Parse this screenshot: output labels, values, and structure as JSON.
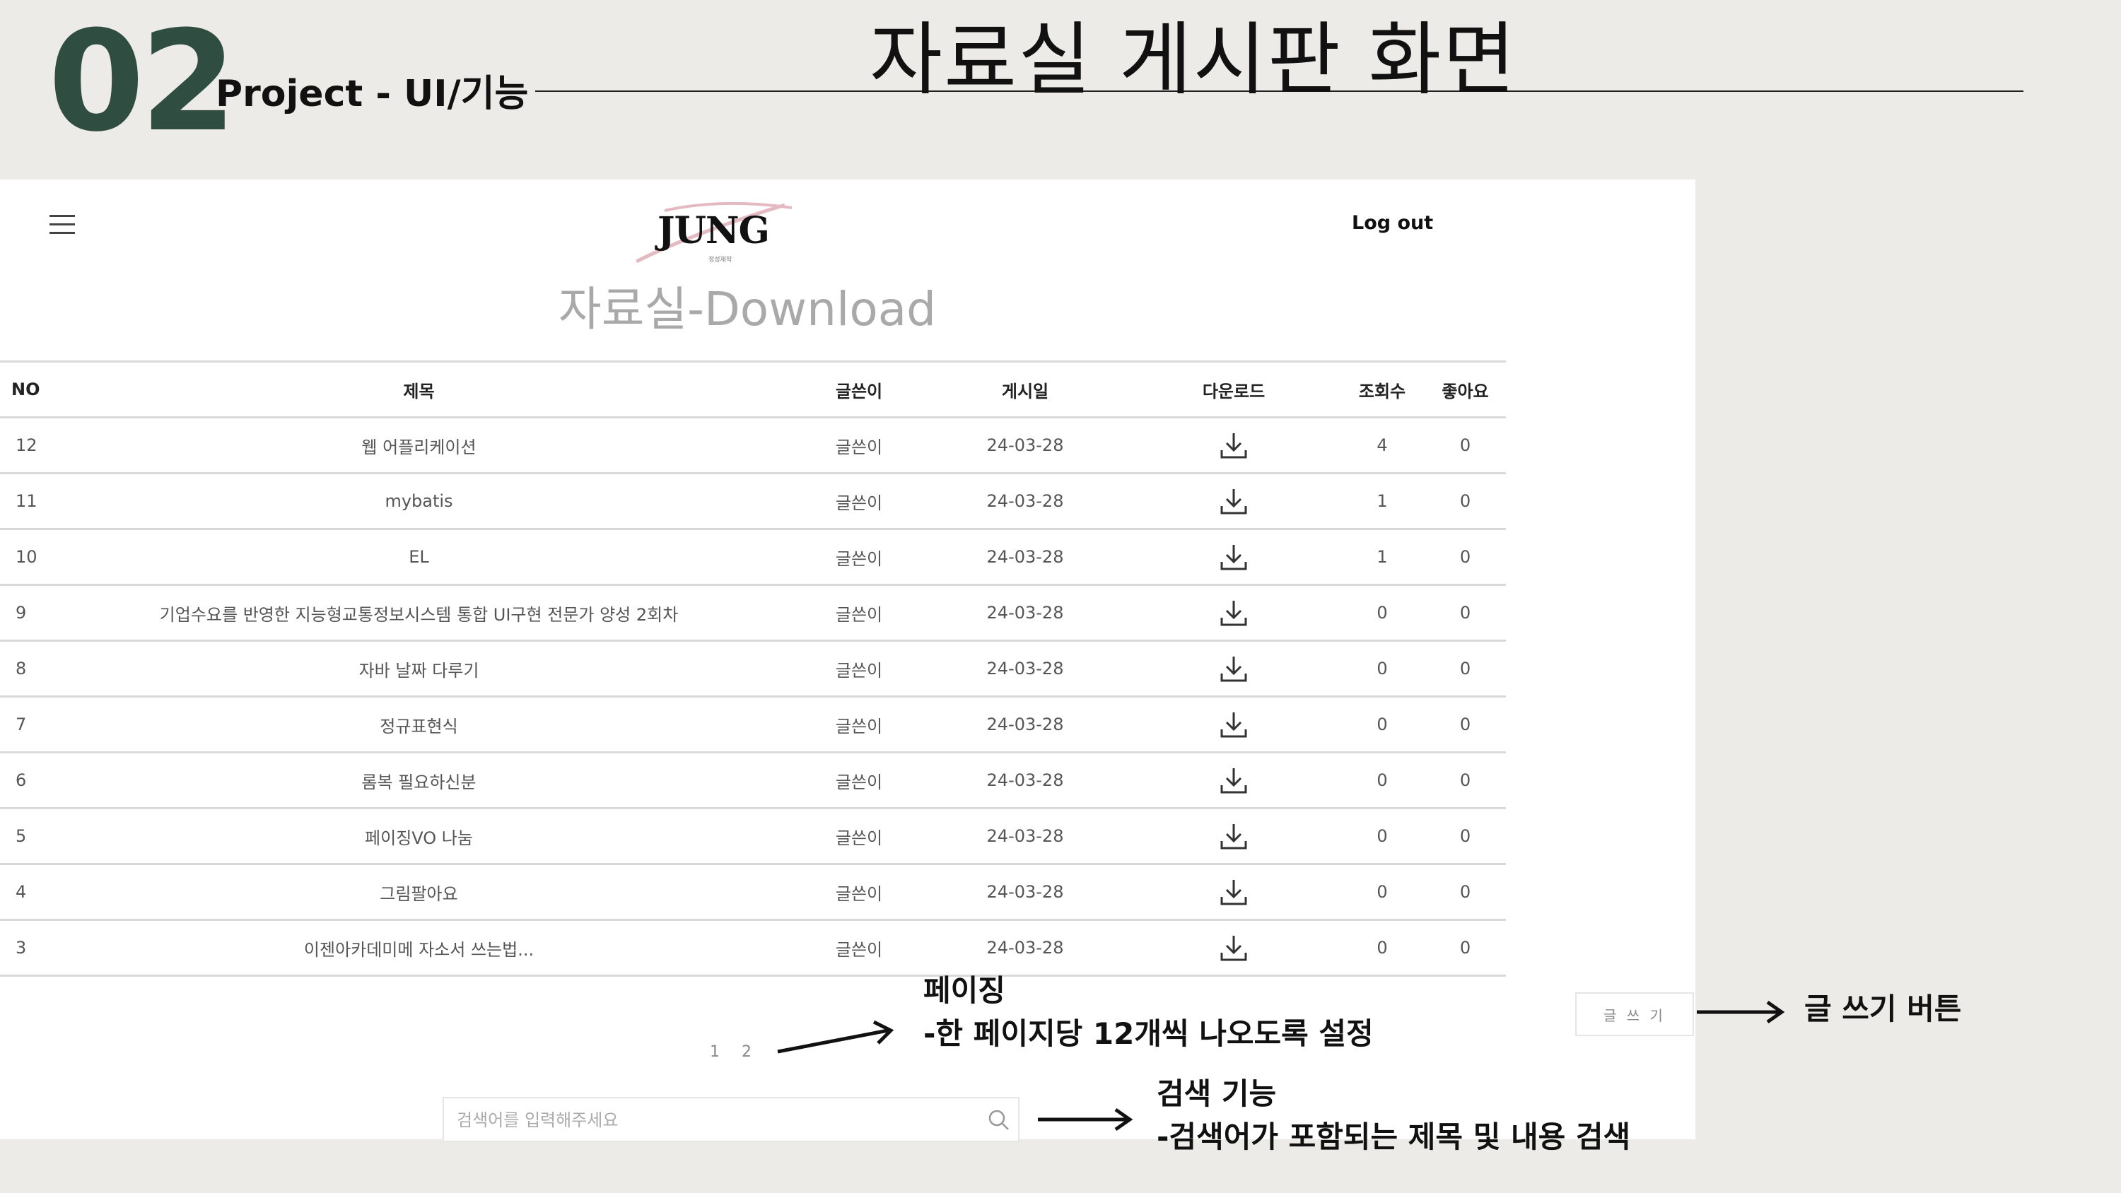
{
  "slide": {
    "number": "02",
    "subtitle": "Project - UI/기능",
    "title": "자료실 게시판 화면"
  },
  "app": {
    "logo_text": "JUNG",
    "logo_sub": "정성재작",
    "logout_label": "Log out",
    "board_title": "자료실-Download"
  },
  "table": {
    "headers": {
      "no": "NO",
      "title": "제목",
      "writer": "글쓴이",
      "date": "게시일",
      "download": "다운로드",
      "views": "조회수",
      "likes": "좋아요"
    },
    "rows": [
      {
        "no": "12",
        "title": "웹 어플리케이션",
        "writer": "글쓴이",
        "date": "24-03-28",
        "views": "4",
        "likes": "0"
      },
      {
        "no": "11",
        "title": "mybatis",
        "writer": "글쓴이",
        "date": "24-03-28",
        "views": "1",
        "likes": "0"
      },
      {
        "no": "10",
        "title": "EL",
        "writer": "글쓴이",
        "date": "24-03-28",
        "views": "1",
        "likes": "0"
      },
      {
        "no": "9",
        "title": "기업수요를 반영한 지능형교통정보시스템 통합 UI구현 전문가 양성 2회차",
        "writer": "글쓴이",
        "date": "24-03-28",
        "views": "0",
        "likes": "0"
      },
      {
        "no": "8",
        "title": "자바 날짜 다루기",
        "writer": "글쓴이",
        "date": "24-03-28",
        "views": "0",
        "likes": "0"
      },
      {
        "no": "7",
        "title": "정규표현식",
        "writer": "글쓴이",
        "date": "24-03-28",
        "views": "0",
        "likes": "0"
      },
      {
        "no": "6",
        "title": "롬복 필요하신분",
        "writer": "글쓴이",
        "date": "24-03-28",
        "views": "0",
        "likes": "0"
      },
      {
        "no": "5",
        "title": "페이징VO 나눔",
        "writer": "글쓴이",
        "date": "24-03-28",
        "views": "0",
        "likes": "0"
      },
      {
        "no": "4",
        "title": "그림팔아요",
        "writer": "글쓴이",
        "date": "24-03-28",
        "views": "0",
        "likes": "0"
      },
      {
        "no": "3",
        "title": "이젠아카데미메 자소서 쓰는법...",
        "writer": "글쓴이",
        "date": "24-03-28",
        "views": "0",
        "likes": "0"
      }
    ]
  },
  "pagination": {
    "pages": [
      "1",
      "2"
    ]
  },
  "search": {
    "placeholder": "검색어를 입력해주세요",
    "value": ""
  },
  "write_button_label": "글 쓰 기",
  "annotations": {
    "paging_title": "페이징",
    "paging_desc": "-한 페이지당 12개씩 나오도록 설정",
    "search_title": "검색 기능",
    "search_desc": "-검색어가 포함되는 제목 및 내용 검색",
    "write_label": "글 쓰기 버튼"
  },
  "colors": {
    "background": "#edebe7",
    "accent": "#2f4d40",
    "panel": "#ffffff",
    "board_title": "#a9a9a9"
  },
  "icons": [
    "menu-icon",
    "download-icon",
    "search-icon",
    "arrow-right-icon"
  ]
}
